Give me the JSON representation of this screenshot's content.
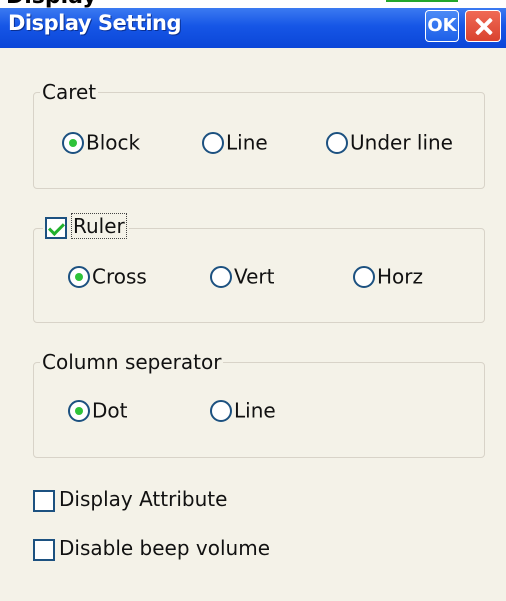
{
  "window": {
    "title": "Display Setting",
    "ok_label": "OK"
  },
  "caret": {
    "label": "Caret",
    "options": [
      "Block",
      "Line",
      "Under line"
    ],
    "selected": "Block"
  },
  "ruler": {
    "label": "Ruler",
    "checked": true,
    "options": [
      "Cross",
      "Vert",
      "Horz"
    ],
    "selected": "Cross"
  },
  "column_separator": {
    "label": "Column seperator",
    "options": [
      "Dot",
      "Line"
    ],
    "selected": "Dot"
  },
  "checkboxes": {
    "display_attribute": {
      "label": "Display Attribute",
      "checked": false
    },
    "disable_beep_volume": {
      "label": "Disable beep volume",
      "checked": false
    }
  },
  "colors": {
    "titlebar": "#1656e6",
    "selected_indicator": "#2fc33a",
    "background": "#f4f2e8"
  }
}
